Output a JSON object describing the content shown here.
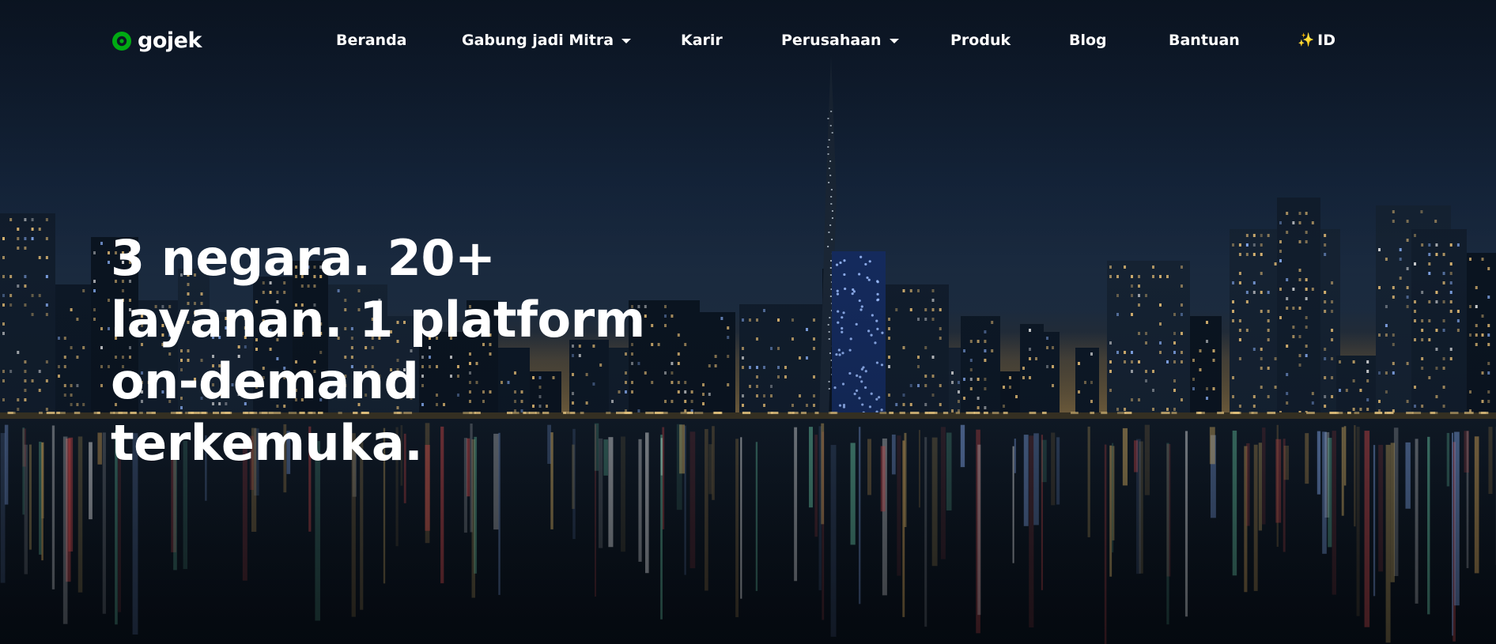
{
  "brand": {
    "name": "gojek",
    "accent": "#00AA13"
  },
  "nav": {
    "items": [
      {
        "label": "Beranda",
        "dropdown": false
      },
      {
        "label": "Gabung jadi Mitra",
        "dropdown": true
      },
      {
        "label": "Karir",
        "dropdown": false
      },
      {
        "label": "Perusahaan",
        "dropdown": true
      },
      {
        "label": "Produk",
        "dropdown": false
      },
      {
        "label": "Blog",
        "dropdown": false
      },
      {
        "label": "Bantuan",
        "dropdown": false
      },
      {
        "label": "ID",
        "dropdown": false,
        "icon": "sparkles-icon"
      }
    ]
  },
  "hero": {
    "headline": "3 negara. 20+ layanan. 1 platform on-demand terkemuka.",
    "background": "night-city-skyline-waterfront"
  }
}
